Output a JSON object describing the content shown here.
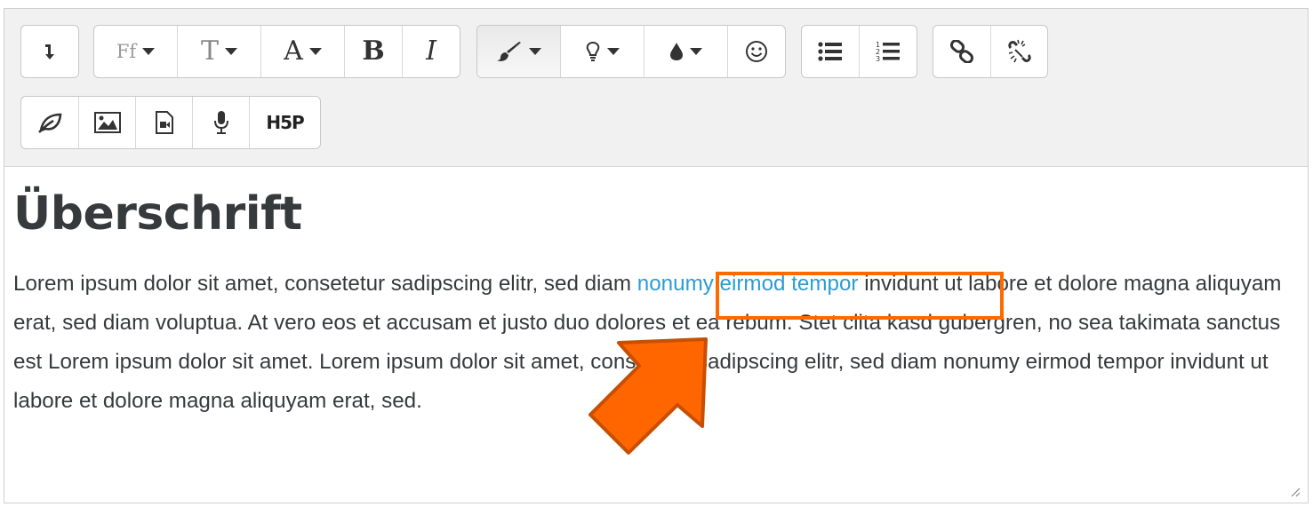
{
  "toolbar": {
    "row1": [
      {
        "name": "collapse-toolbar-button",
        "icon": "arrow-down-icon"
      },
      {
        "name": "font-family-button",
        "label": "Ff"
      },
      {
        "name": "font-size-button",
        "label": "T"
      },
      {
        "name": "font-color-button",
        "label": "A"
      },
      {
        "name": "bold-button",
        "label": "B"
      },
      {
        "name": "italic-button",
        "label": "I"
      },
      {
        "name": "styles-button",
        "icon": "brush-icon"
      },
      {
        "name": "highlight-button",
        "icon": "lightbulb-icon"
      },
      {
        "name": "background-color-button",
        "icon": "drop-icon"
      },
      {
        "name": "emoji-button",
        "icon": "smiley-icon"
      },
      {
        "name": "unordered-list-button",
        "icon": "list-icon"
      },
      {
        "name": "ordered-list-button",
        "icon": "numbered-list-icon"
      },
      {
        "name": "link-button",
        "icon": "link-icon"
      },
      {
        "name": "unlink-button",
        "icon": "unlink-icon"
      }
    ],
    "row2": [
      {
        "name": "recordrtc-button",
        "icon": "leaf-icon"
      },
      {
        "name": "insert-image-button",
        "icon": "image-icon"
      },
      {
        "name": "insert-media-button",
        "icon": "video-file-icon"
      },
      {
        "name": "record-audio-button",
        "icon": "microphone-icon"
      },
      {
        "name": "insert-h5p-button",
        "label": "H5P"
      }
    ]
  },
  "content": {
    "heading": "Überschrift",
    "para_before": "Lorem ipsum dolor sit amet, consetetur sadipscing elitr, sed diam ",
    "link_text": "nonumy eirmod tempor",
    "para_after": " invidunt ut labore et dolore magna aliquyam erat, sed diam voluptua. At vero eos et accusam et justo duo dolores et ea rebum. Stet clita kasd gubergren, no sea takimata sanctus est Lorem ipsum dolor sit amet. Lorem ipsum dolor sit amet, consetetur sadipscing elitr, sed diam nonumy eirmod tempor invidunt ut labore et dolore magna aliquyam erat, sed."
  },
  "colors": {
    "link": "#2d9cd4",
    "highlight_border": "#ff6a00",
    "arrow_fill": "#ff6600",
    "arrow_stroke": "#c84f00",
    "text": "#373a3c",
    "toolbar_bg": "#f1f1f1"
  }
}
